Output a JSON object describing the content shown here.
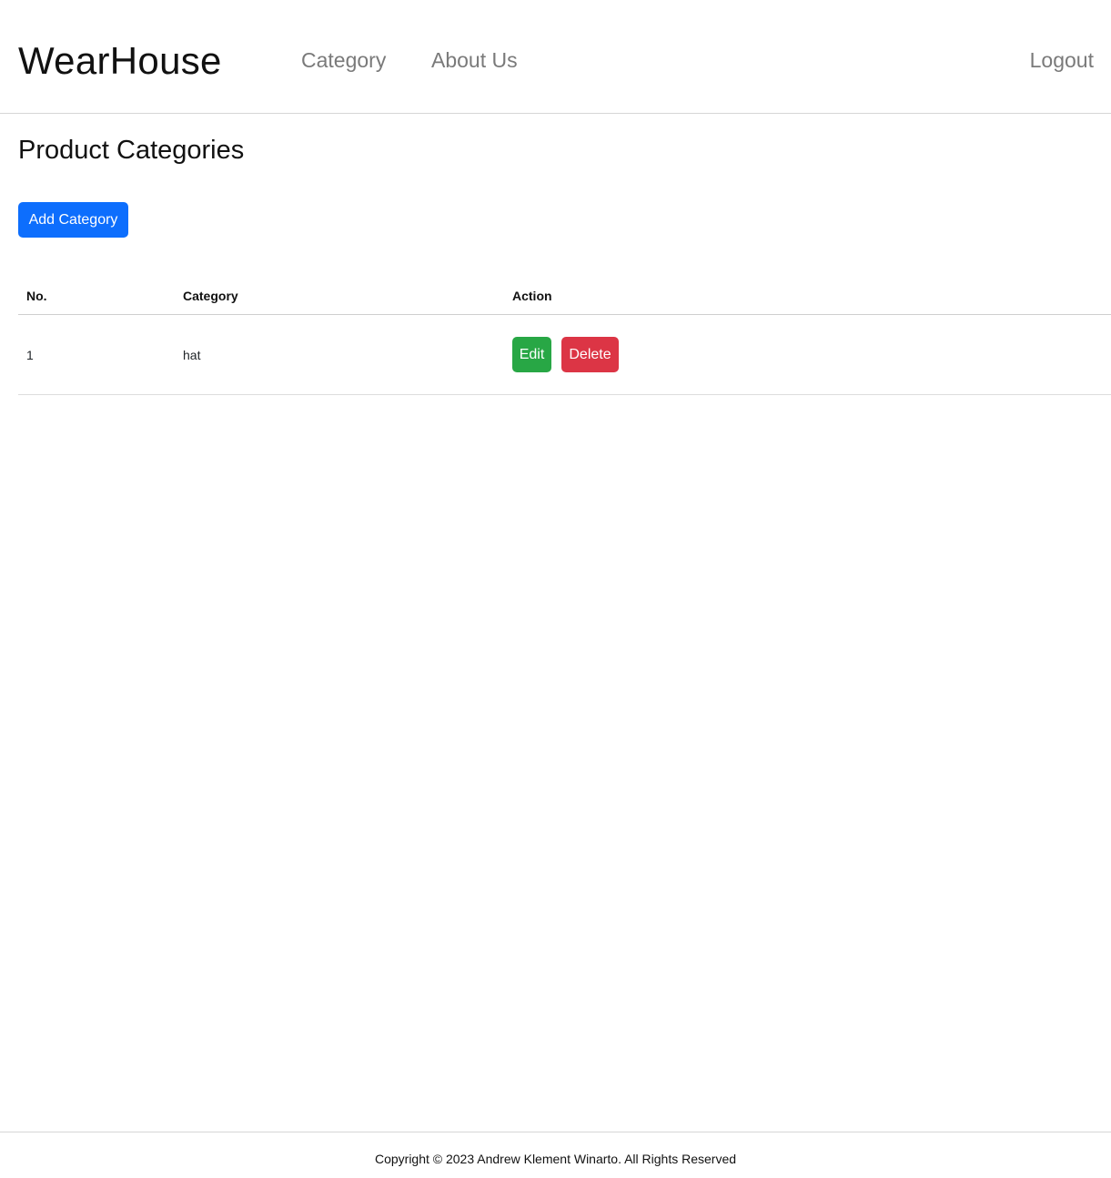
{
  "navbar": {
    "brand": "WearHouse",
    "links": {
      "category": "Category",
      "about": "About Us",
      "logout": "Logout"
    }
  },
  "main": {
    "title": "Product Categories",
    "add_button_label": "Add Category",
    "table": {
      "headers": {
        "no": "No.",
        "category": "Category",
        "action": "Action"
      },
      "rows": [
        {
          "no": "1",
          "category": "hat",
          "edit_label": "Edit",
          "delete_label": "Delete"
        }
      ]
    }
  },
  "footer": {
    "text": "Copyright © 2023 Andrew Klement Winarto. All Rights Reserved"
  },
  "colors": {
    "primary": "#0d6efd",
    "success": "#28a745",
    "danger": "#dc3545",
    "nav_link": "#7a7a7a"
  }
}
